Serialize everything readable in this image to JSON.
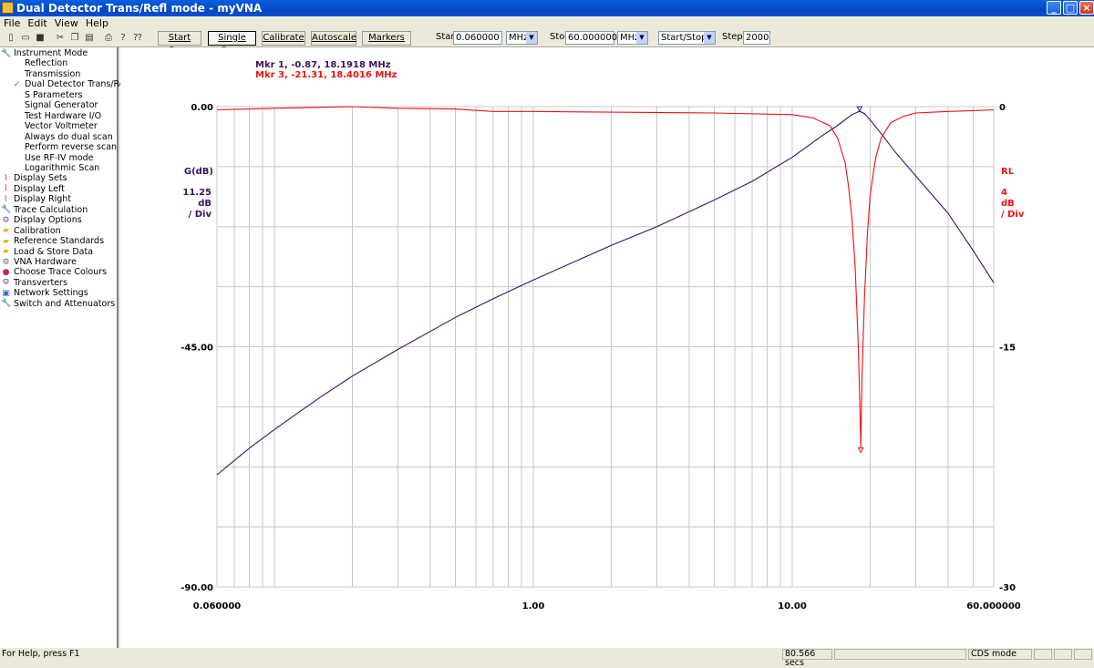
{
  "window": {
    "title": "Dual Detector Trans/Refl mode - myVNA"
  },
  "menu": [
    "File",
    "Edit",
    "View",
    "Help"
  ],
  "toolbar": {
    "start_scan": "Start Scan",
    "single_scan": "Single Scan",
    "calibrate": "Calibrate",
    "autoscale": "Autoscale",
    "markers": "Markers",
    "start_label": "Start",
    "start_value": "0.060000",
    "start_unit": "MHz",
    "stop_label": "Stop",
    "stop_value": "60.000000",
    "stop_unit": "MHz",
    "range_mode": "Start/Stop",
    "steps_label": "Steps",
    "steps_value": "2000"
  },
  "tree": [
    {
      "label": "Instrument Mode",
      "icon": "wrench-icon",
      "level": 0
    },
    {
      "label": "Reflection",
      "icon": "",
      "level": 1
    },
    {
      "label": "Transmission",
      "icon": "",
      "level": 1
    },
    {
      "label": "Dual Detector Trans/Refl",
      "icon": "checkmark-icon",
      "level": 1
    },
    {
      "label": "S Parameters",
      "icon": "",
      "level": 1
    },
    {
      "label": "Signal Generator",
      "icon": "",
      "level": 1
    },
    {
      "label": "Test Hardware I/O",
      "icon": "",
      "level": 1
    },
    {
      "label": "Vector Voltmeter",
      "icon": "",
      "level": 1
    },
    {
      "label": "Always do dual scan",
      "icon": "",
      "level": 1
    },
    {
      "label": "Perform reverse scan",
      "icon": "",
      "level": 1
    },
    {
      "label": "Use RF-IV mode",
      "icon": "",
      "level": 1
    },
    {
      "label": "Logarithmic Scan",
      "icon": "",
      "level": 1
    },
    {
      "label": "Display Sets",
      "icon": "graph-icon",
      "level": 0
    },
    {
      "label": "Display Left",
      "icon": "graph-icon",
      "level": 0
    },
    {
      "label": "Display Right",
      "icon": "graph-icon",
      "level": 0
    },
    {
      "label": "Trace Calculation",
      "icon": "wrench-icon",
      "level": 0
    },
    {
      "label": "Display Options",
      "icon": "gear-icon",
      "level": 0
    },
    {
      "label": "Calibration",
      "icon": "folder-icon",
      "level": 0
    },
    {
      "label": "Reference Standards",
      "icon": "folder-icon",
      "level": 0
    },
    {
      "label": "Load & Store Data",
      "icon": "folder-icon",
      "level": 0
    },
    {
      "label": "VNA Hardware",
      "icon": "gear-icon",
      "level": 0
    },
    {
      "label": "Choose Trace Colours",
      "icon": "palette-icon",
      "level": 0
    },
    {
      "label": "Transverters",
      "icon": "gear-icon",
      "level": 0
    },
    {
      "label": "Network Settings",
      "icon": "network-icon",
      "level": 0
    },
    {
      "label": "Switch and Attenuators",
      "icon": "wrench-icon",
      "level": 0
    }
  ],
  "plot": {
    "marker1": "Mkr 1, -0.87, 18.1918 MHz",
    "marker3": "Mkr 3, -21.31, 18.4016 MHz",
    "left_axis": {
      "title": "G(dB)",
      "scale": "11.25",
      "unit": "dB",
      "per": "/ Div",
      "ticks": [
        "0.00",
        "-45.00",
        "-90.00"
      ]
    },
    "right_axis": {
      "title": "RL",
      "scale": "4",
      "unit": "dB",
      "per": "/ Div",
      "ticks": [
        "0",
        "-15",
        "-30"
      ]
    },
    "x_ticks": [
      "0.060000",
      "1.00",
      "10.00",
      "60.000000"
    ],
    "colors": {
      "gain": "#3f1060",
      "rl": "#ee1111",
      "grid": "#c8c8c8"
    }
  },
  "chart_data": {
    "type": "line",
    "x_scale": "log",
    "xlim": [
      0.06,
      60
    ],
    "y_left_lim": [
      -90,
      0
    ],
    "y_right_lim": [
      -30,
      0
    ],
    "series": [
      {
        "name": "G(dB)",
        "axis": "left",
        "x": [
          0.06,
          0.08,
          0.1,
          0.15,
          0.2,
          0.3,
          0.5,
          0.7,
          1,
          2,
          3,
          5,
          7,
          10,
          13,
          15,
          17,
          18.19,
          19,
          20,
          22,
          25,
          30,
          40,
          50,
          60
        ],
        "y": [
          -69,
          -64,
          -60.5,
          -54.5,
          -50.5,
          -45.5,
          -39.5,
          -36,
          -32.5,
          -26,
          -22.5,
          -17.5,
          -14,
          -9.5,
          -5.5,
          -3.5,
          -1.5,
          -0.87,
          -1.3,
          -2.5,
          -5,
          -8.5,
          -13,
          -20,
          -27,
          -33
        ]
      },
      {
        "name": "RL",
        "axis": "right",
        "x": [
          0.06,
          0.1,
          0.2,
          0.3,
          0.5,
          0.7,
          1,
          2,
          5,
          10,
          12,
          14,
          15,
          16,
          16.5,
          17,
          17.5,
          18,
          18.2,
          18.4016,
          18.6,
          19,
          19.5,
          20,
          21,
          22,
          24,
          27,
          30,
          40,
          50,
          60
        ],
        "y": [
          -0.2,
          -0.1,
          0,
          -0.1,
          -0.15,
          -0.3,
          -0.3,
          -0.35,
          -0.4,
          -0.5,
          -0.7,
          -1.2,
          -2,
          -3.5,
          -5,
          -7,
          -10,
          -15,
          -18,
          -21.31,
          -17,
          -12,
          -8,
          -5.5,
          -3.2,
          -2,
          -1,
          -0.6,
          -0.4,
          -0.3,
          -0.25,
          -0.2
        ]
      }
    ]
  },
  "status": {
    "help": "For Help, press F1",
    "time": "80.566 secs",
    "mode": "CDS mode"
  }
}
